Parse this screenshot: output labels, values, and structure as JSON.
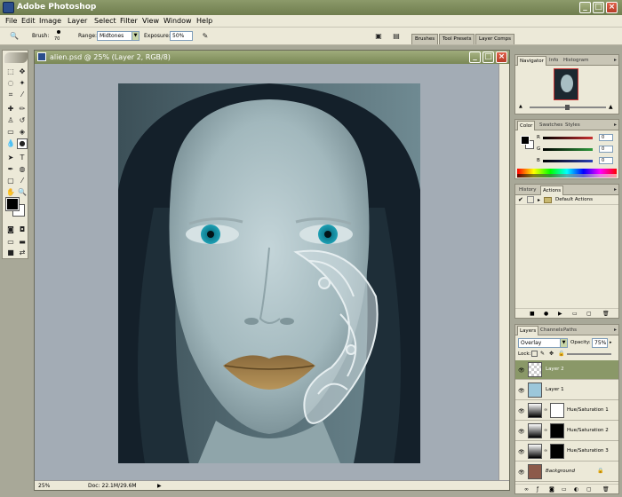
{
  "app": {
    "title": "Adobe Photoshop"
  },
  "menu": [
    "File",
    "Edit",
    "Image",
    "Layer",
    "Select",
    "Filter",
    "View",
    "Window",
    "Help"
  ],
  "options": {
    "brush_label": "Brush:",
    "brush_size": "70",
    "range_label": "Range:",
    "range_value": "Midtones",
    "exposure_label": "Exposure:",
    "exposure_value": "50%",
    "well_tabs": [
      "Brushes",
      "Tool Presets",
      "Layer Comps"
    ]
  },
  "document": {
    "title": "alien.psd @ 25% (Layer 2, RGB/8)",
    "zoom": "25%",
    "doc_size": "Doc: 22.1M/29.6M"
  },
  "navigator": {
    "tabs": [
      "Navigator",
      "Info",
      "Histogram"
    ]
  },
  "color_palette": {
    "tabs": [
      "Color",
      "Swatches",
      "Styles"
    ],
    "channels": [
      {
        "label": "R",
        "value": "0",
        "color": "#c83030"
      },
      {
        "label": "G",
        "value": "0",
        "color": "#2f9a3c"
      },
      {
        "label": "B",
        "value": "0",
        "color": "#2a3fb5"
      }
    ]
  },
  "history_palette": {
    "tabs": [
      "History",
      "Actions"
    ],
    "items": [
      "Default Actions"
    ]
  },
  "layers_palette": {
    "tabs": [
      "Layers",
      "Channels",
      "Paths"
    ],
    "blend_mode": "Overlay",
    "opacity_label": "Opacity:",
    "opacity_value": "75%",
    "lock_label": "Lock:",
    "layers": [
      {
        "name": "Layer 2",
        "selected": true
      },
      {
        "name": "Layer 1",
        "selected": false
      },
      {
        "name": "Hue/Saturation 1",
        "selected": false
      },
      {
        "name": "Hue/Saturation 2",
        "selected": false
      },
      {
        "name": "Hue/Saturation 3",
        "selected": false
      },
      {
        "name": "Background",
        "selected": false
      }
    ]
  },
  "colors": {
    "title_bar": "#7a8856",
    "panel_bg": "#ece9d8",
    "workspace": "#a3acb5",
    "selection": "#8a9868"
  }
}
